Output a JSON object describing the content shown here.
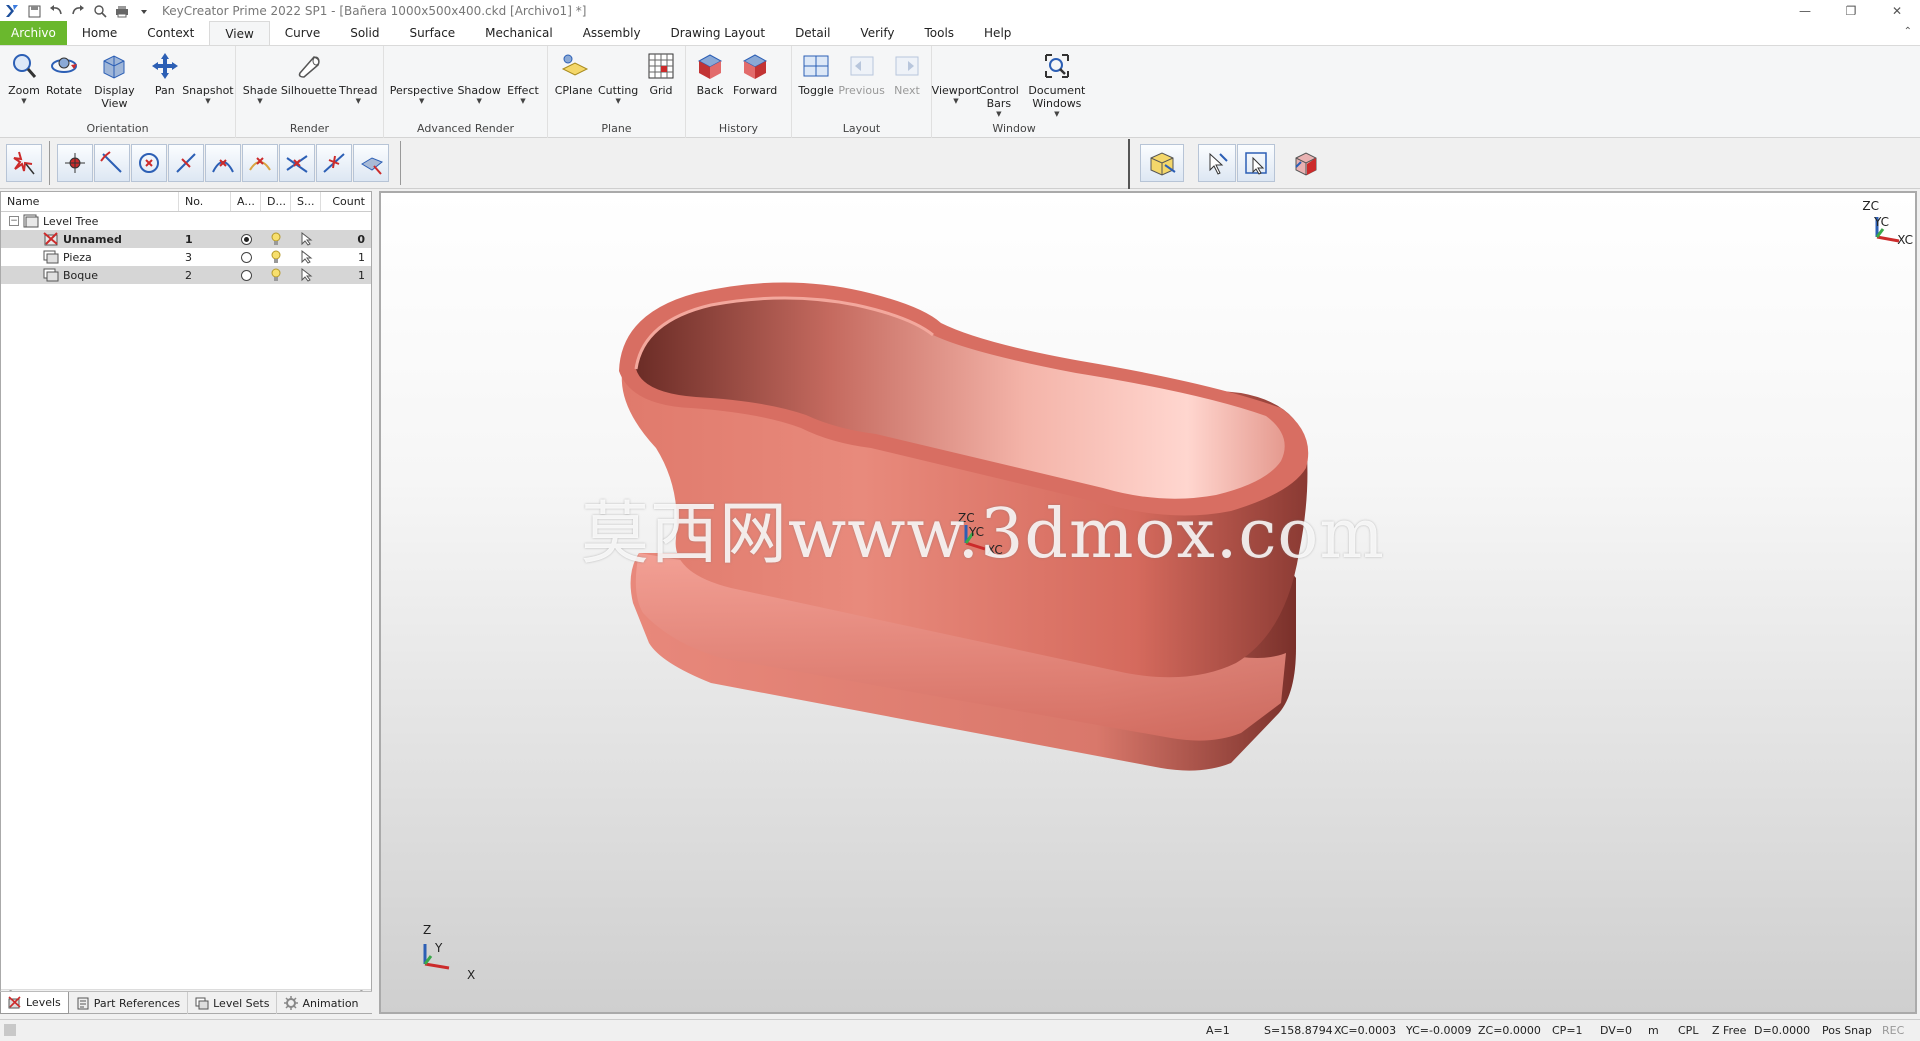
{
  "window": {
    "title": "KeyCreator Prime 2022 SP1 - [Bañera 1000x500x400.ckd [Archivo1] *]"
  },
  "menu": {
    "tabs": [
      "Archivo",
      "Home",
      "Context",
      "View",
      "Curve",
      "Solid",
      "Surface",
      "Mechanical",
      "Assembly",
      "Drawing Layout",
      "Detail",
      "Verify",
      "Tools",
      "Help"
    ]
  },
  "ribbon": {
    "orientation": {
      "label": "Orientation",
      "zoom": "Zoom",
      "rotate": "Rotate",
      "display_view": "Display View",
      "pan": "Pan",
      "snapshot": "Snapshot"
    },
    "render": {
      "label": "Render",
      "shade": "Shade",
      "silhouette": "Silhouette",
      "thread": "Thread"
    },
    "advanced_render": {
      "label": "Advanced Render",
      "perspective": "Perspective",
      "shadow": "Shadow",
      "effect": "Effect"
    },
    "plane": {
      "label": "Plane",
      "cplane": "CPlane",
      "cutting": "Cutting",
      "grid": "Grid"
    },
    "history": {
      "label": "History",
      "back": "Back",
      "forward": "Forward"
    },
    "layout": {
      "label": "Layout",
      "toggle": "Toggle",
      "previous": "Previous",
      "next": "Next"
    },
    "window": {
      "label": "Window",
      "viewport": "Viewport",
      "control_bars": "Control Bars",
      "document_windows": "Document Windows"
    }
  },
  "levels": {
    "columns": [
      "Name",
      "No.",
      "A...",
      "D...",
      "S...",
      "Count"
    ],
    "root": "Level Tree",
    "rows": [
      {
        "name": "Unnamed",
        "no": "1",
        "count": "0"
      },
      {
        "name": "Pieza",
        "no": "3",
        "count": "1"
      },
      {
        "name": "Boque",
        "no": "2",
        "count": "1"
      }
    ]
  },
  "bottom_tabs": [
    "Levels",
    "Part References",
    "Level Sets",
    "Animation"
  ],
  "viewport": {
    "watermark": "莫西网www.3dmox.com",
    "axis_labels": {
      "z": "Z",
      "y": "Y",
      "x": "X",
      "zc": "ZC",
      "yc": "YC",
      "xc": "XC"
    },
    "model_color": "#e8857a"
  },
  "status": {
    "a": "A=1",
    "s": "S=158.8794",
    "xc": "XC=0.0003",
    "yc": "YC=-0.0009",
    "zc": "ZC=0.0000",
    "cp": "CP=1",
    "dv": "DV=0",
    "unit": "m",
    "cpl": "CPL",
    "zfree": "Z Free",
    "d": "D=0.0000",
    "possnap": "Pos Snap",
    "rec": "REC"
  },
  "colors": {
    "file_tab": "#6ab82d",
    "accent_red": "#cc2b2b",
    "accent_blue": "#2c5fb5"
  }
}
